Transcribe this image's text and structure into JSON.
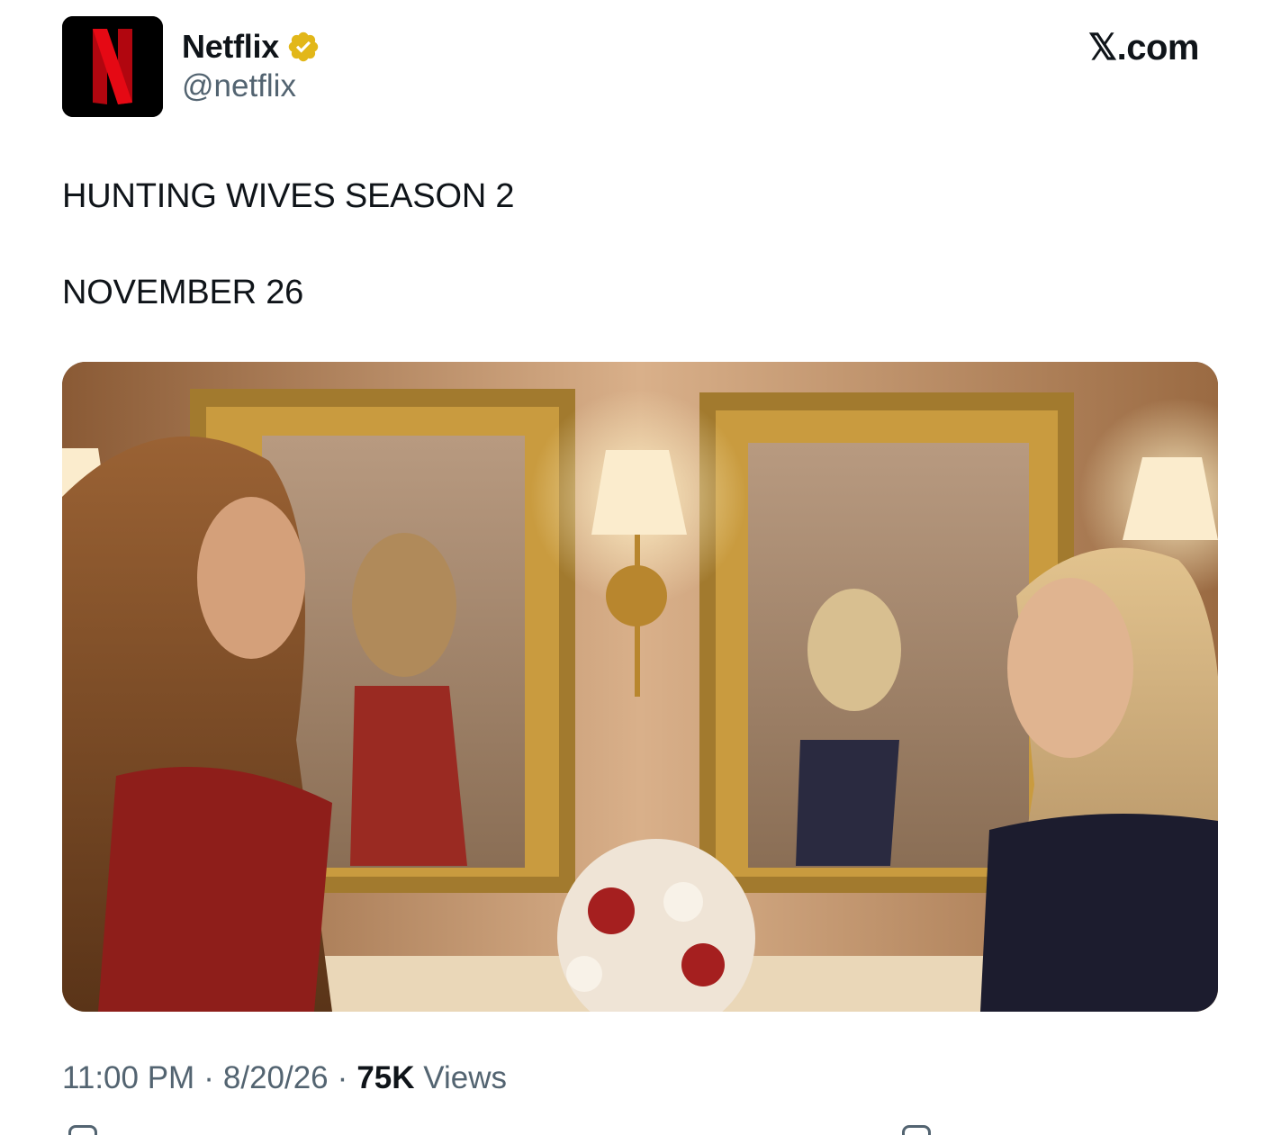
{
  "author": {
    "display_name": "Netflix",
    "handle": "@netflix",
    "avatar_letter": "N",
    "avatar_color": "#e50914",
    "verified_color": "#e2b719"
  },
  "brand": {
    "label": "𝕏.com"
  },
  "tweet": {
    "line1": "HUNTING WIVES SEASON 2",
    "line2": "NOVEMBER 26"
  },
  "meta": {
    "time": "11:00 PM",
    "date": "8/20/26",
    "views_count": "75K",
    "views_label": "Views",
    "separator": "·"
  },
  "icons": {
    "verified": "verified-badge-icon",
    "reply": "reply-icon",
    "share": "share-icon"
  }
}
